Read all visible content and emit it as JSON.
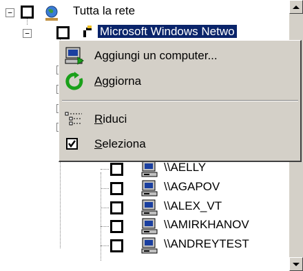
{
  "tree": {
    "root_label": "Tutta la rete",
    "network_label": "Microsoft Windows Netwo",
    "computers": [
      "\\\\AELLY",
      "\\\\AGAPOV",
      "\\\\ALEX_VT",
      "\\\\AMIRKHANOV",
      "\\\\ANDREYTEST"
    ]
  },
  "context_menu": {
    "items": [
      {
        "label": "Aggiungi un computer...",
        "icon": "add-computer-icon"
      },
      {
        "label_accel": "A",
        "label_rest": "ggiorna",
        "icon": "refresh-icon"
      },
      {
        "label_accel": "R",
        "label_rest": "iduci",
        "icon": "collapse-list-icon"
      },
      {
        "label_accel": "S",
        "label_rest": "eleziona",
        "icon": "checkbox-checked-icon"
      }
    ]
  },
  "colors": {
    "selection": "#0a246a",
    "menu_bg": "#d4d0c8",
    "refresh_green": "#1aa01a"
  }
}
